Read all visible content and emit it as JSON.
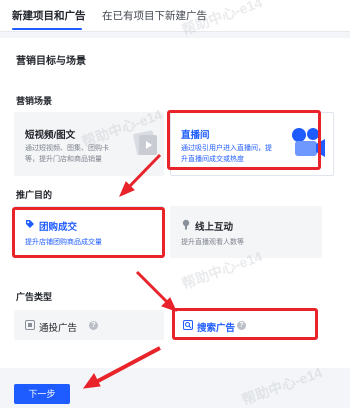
{
  "tabs": [
    {
      "label": "新建项目和广告"
    },
    {
      "label": "在已有项目下新建广告"
    }
  ],
  "section": {
    "title": "营销目标与场景"
  },
  "scene": {
    "label": "营销场景",
    "options": [
      {
        "title": "短视频/图文",
        "desc_line1": "通过短视频、图集、团购卡",
        "desc_line2": "等，提升门店和商品销量"
      },
      {
        "title": "直播间",
        "desc_line1": "通过吸引用户进入直播间，提",
        "desc_line2": "升直播间成交或热度"
      }
    ]
  },
  "purpose": {
    "label": "推广目的",
    "options": [
      {
        "title": "团购成交",
        "desc": "提升店铺团购商品成交量"
      },
      {
        "title": "线上互动",
        "desc": "提升直播观看人数等"
      }
    ]
  },
  "ad_type": {
    "label": "广告类型",
    "options": [
      {
        "title": "通投广告",
        "help": "?"
      },
      {
        "title": "搜索广告",
        "help": "?"
      }
    ]
  },
  "next_button": {
    "label": "下一步"
  },
  "watermark": {
    "text": "帮助中心-e14"
  },
  "colors": {
    "accent": "#1f5cff",
    "annotation_red": "#e8232a"
  }
}
